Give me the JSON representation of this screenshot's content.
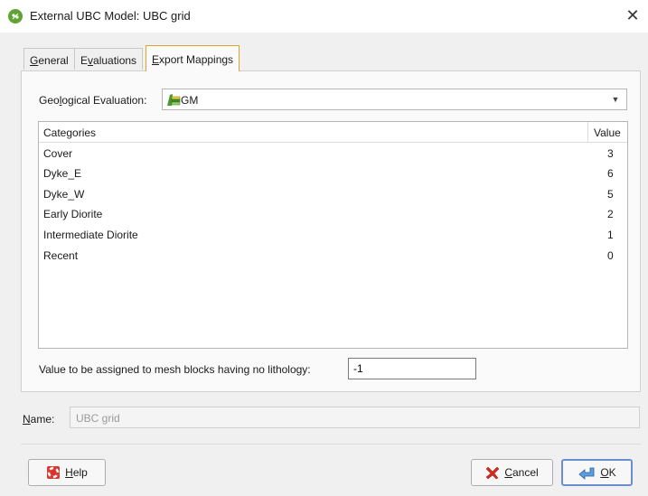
{
  "window": {
    "title": "External UBC Model: UBC grid",
    "close_symbol": "✕"
  },
  "tabs": [
    {
      "label": "General",
      "mnemonic": "G",
      "rest": "eneral",
      "active": false
    },
    {
      "label": "Evaluations",
      "mnemonic_prefix": "E",
      "mnemonic": "v",
      "rest": "aluations",
      "active": false
    },
    {
      "label": "Export Mappings",
      "mnemonic": "E",
      "rest": "xport Mappings",
      "active": true
    }
  ],
  "export_mappings": {
    "geo_eval_label_pre": "Geo",
    "geo_eval_label_mn": "l",
    "geo_eval_label_post": "ogical Evaluation:",
    "geo_eval_value": "GM",
    "table": {
      "headers": [
        "Categories",
        "Value"
      ],
      "rows": [
        {
          "category": "Cover",
          "value": "3"
        },
        {
          "category": "Dyke_E",
          "value": "6"
        },
        {
          "category": "Dyke_W",
          "value": "5"
        },
        {
          "category": "Early Diorite",
          "value": "2"
        },
        {
          "category": "Intermediate Diorite",
          "value": "1"
        },
        {
          "category": "Recent",
          "value": "0"
        }
      ]
    },
    "no_lithology_label": "Value to be assigned to mesh blocks having no lithology:",
    "no_lithology_value": "-1"
  },
  "name": {
    "label_mn": "N",
    "label_rest": "ame:",
    "value": "UBC grid"
  },
  "buttons": {
    "help": {
      "mn": "H",
      "rest": "elp",
      "icon": "lifebuoy-icon"
    },
    "cancel": {
      "mn": "C",
      "rest": "ancel",
      "icon": "red-x-icon"
    },
    "ok": {
      "mn": "O",
      "rest": "K",
      "icon": "green-arrow-icon"
    }
  },
  "colors": {
    "active_tab_border": "#e0a22b",
    "ok_border": "#6a8fd0",
    "app_icon": "#5fa432"
  }
}
